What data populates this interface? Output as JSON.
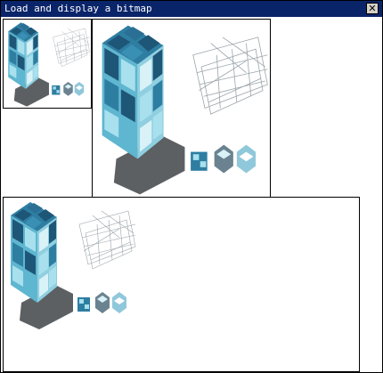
{
  "window": {
    "title": "Load and display a bitmap",
    "close_icon": "close-icon"
  },
  "bitmap": {
    "colors": {
      "dark": "#1e5677",
      "mid": "#2e7ea2",
      "light": "#a8e0ee",
      "pale": "#d8f2f8",
      "shadow": "#404448",
      "titlebar": "#0a246a"
    }
  }
}
